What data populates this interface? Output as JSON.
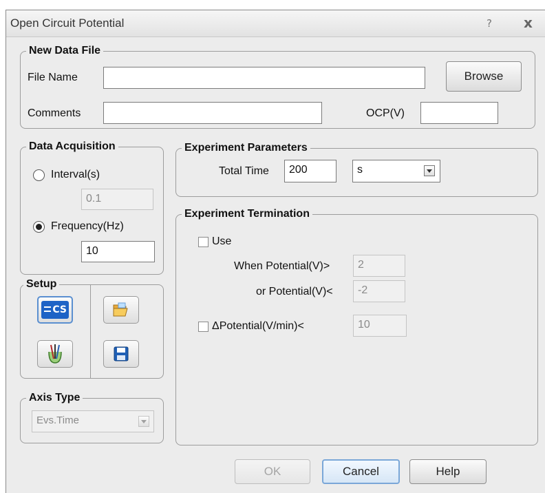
{
  "window": {
    "title": "Open Circuit Potential",
    "help_glyph": "?",
    "close_glyph": "x"
  },
  "new_data_file": {
    "legend": "New Data File",
    "file_name_label": "File Name",
    "file_name_value": "",
    "browse_label": "Browse",
    "comments_label": "Comments",
    "comments_value": "",
    "ocp_label": "OCP(V)",
    "ocp_value": ""
  },
  "data_acquisition": {
    "legend": "Data Acquisition",
    "interval_label": "Interval(s)",
    "interval_value": "0.1",
    "interval_selected": false,
    "frequency_label": "Frequency(Hz)",
    "frequency_value": "10",
    "frequency_selected": true
  },
  "setup": {
    "legend": "Setup",
    "tools": [
      {
        "icon": "cs-instrument-icon",
        "badge": "CS"
      },
      {
        "icon": "open-folder-icon"
      },
      {
        "icon": "electrode-cell-icon"
      },
      {
        "icon": "save-disk-icon"
      }
    ]
  },
  "axis_type": {
    "legend": "Axis Type",
    "value": "Evs.Time"
  },
  "experiment_parameters": {
    "legend": "Experiment Parameters",
    "total_time_label": "Total Time",
    "total_time_value": "200",
    "unit_value": "s"
  },
  "experiment_termination": {
    "legend": "Experiment Termination",
    "use_label": "Use",
    "use_checked": false,
    "when_potential_label": "When Potential(V)>",
    "when_potential_value": "2",
    "or_potential_label": "or Potential(V)<",
    "or_potential_value": "-2",
    "delta_label": "ΔPotential(V/min)<",
    "delta_checked": false,
    "delta_value": "10"
  },
  "buttons": {
    "ok": "OK",
    "cancel": "Cancel",
    "help": "Help"
  },
  "colors": {
    "dialog_bg": "#ececec",
    "default_button_border": "#7aa7d8",
    "cs_icon_blue": "#1e63c6"
  }
}
